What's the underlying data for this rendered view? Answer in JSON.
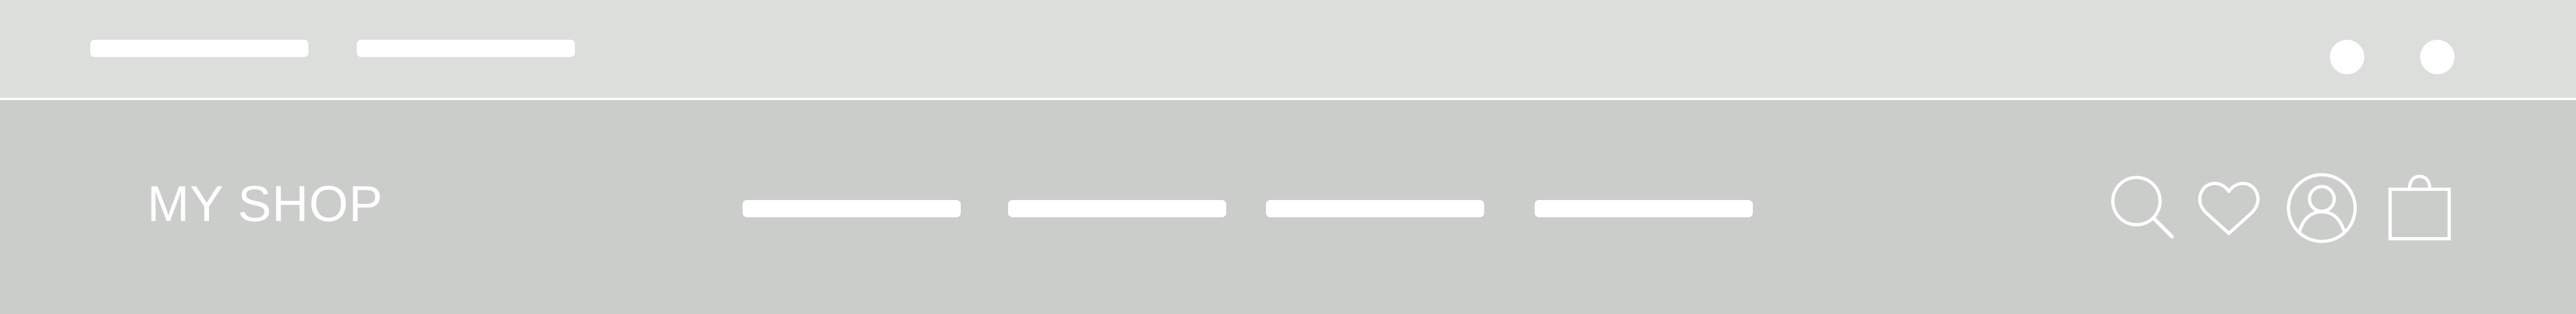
{
  "header": {
    "top_bar": {
      "left_links": [
        {
          "label": ""
        },
        {
          "label": ""
        }
      ],
      "right_actions": [
        {
          "icon": "circle-dot-icon"
        },
        {
          "icon": "circle-dot-icon"
        }
      ]
    },
    "main_bar": {
      "logo_text": "MY SHOP",
      "nav_items": [
        {
          "label": ""
        },
        {
          "label": ""
        },
        {
          "label": ""
        },
        {
          "label": ""
        }
      ],
      "actions": [
        {
          "icon": "search-icon"
        },
        {
          "icon": "heart-icon"
        },
        {
          "icon": "user-icon"
        },
        {
          "icon": "shopping-bag-icon"
        }
      ]
    }
  },
  "colors": {
    "top_bar_bg": "#dcdedc",
    "main_bar_bg": "#cbcdcb",
    "foreground": "#ffffff"
  }
}
